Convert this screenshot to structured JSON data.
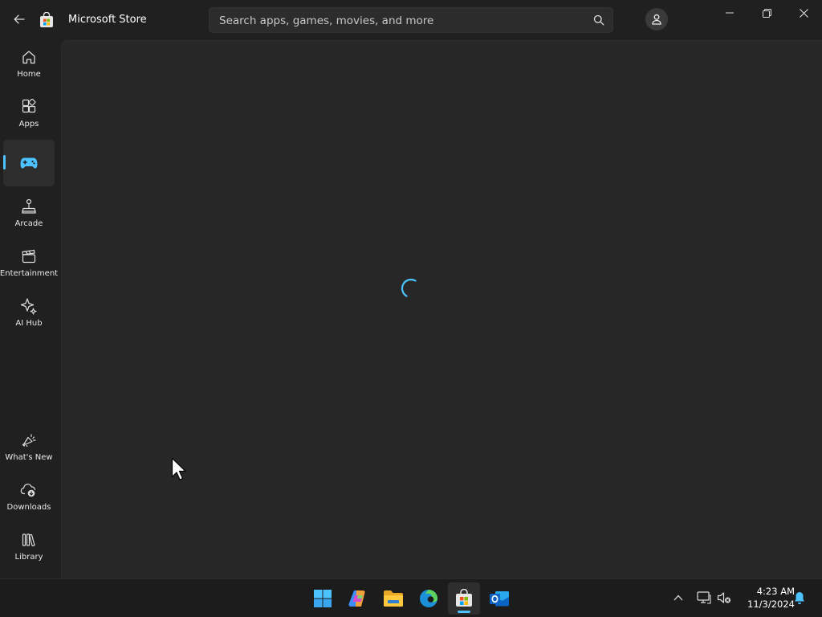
{
  "window": {
    "title": "Microsoft Store",
    "controls": [
      "minimize",
      "restore",
      "close"
    ]
  },
  "search": {
    "placeholder": "Search apps, games, movies, and more",
    "value": ""
  },
  "sidebar": {
    "items": [
      {
        "label": "Home",
        "icon": "home-icon"
      },
      {
        "label": "Apps",
        "icon": "apps-icon"
      },
      {
        "label": "",
        "icon": "gaming-controller-icon",
        "selected": true
      },
      {
        "label": "Arcade",
        "icon": "joystick-icon"
      },
      {
        "label": "Entertainment",
        "icon": "clapperboard-icon"
      },
      {
        "label": "AI Hub",
        "icon": "sparkle-icon"
      }
    ],
    "bottom_items": [
      {
        "label": "What's New",
        "icon": "megaphone-icon"
      },
      {
        "label": "Downloads",
        "icon": "cloud-download-icon"
      },
      {
        "label": "Library",
        "icon": "library-icon"
      }
    ]
  },
  "main": {
    "state": "loading"
  },
  "taskbar": {
    "apps": [
      {
        "name": "Start",
        "icon": "windows-start-icon"
      },
      {
        "name": "Copilot",
        "icon": "copilot-icon"
      },
      {
        "name": "File Explorer",
        "icon": "file-explorer-icon"
      },
      {
        "name": "Microsoft Edge",
        "icon": "edge-icon"
      },
      {
        "name": "Microsoft Store",
        "icon": "store-icon",
        "active": true
      },
      {
        "name": "Outlook",
        "icon": "outlook-icon"
      }
    ],
    "clock": {
      "time": "4:23 AM",
      "date": "11/3/2024"
    }
  },
  "colors": {
    "accent": "#4cc2ff",
    "background": "#202020",
    "content_background": "#272727",
    "taskbar": "#1c1c1c"
  }
}
